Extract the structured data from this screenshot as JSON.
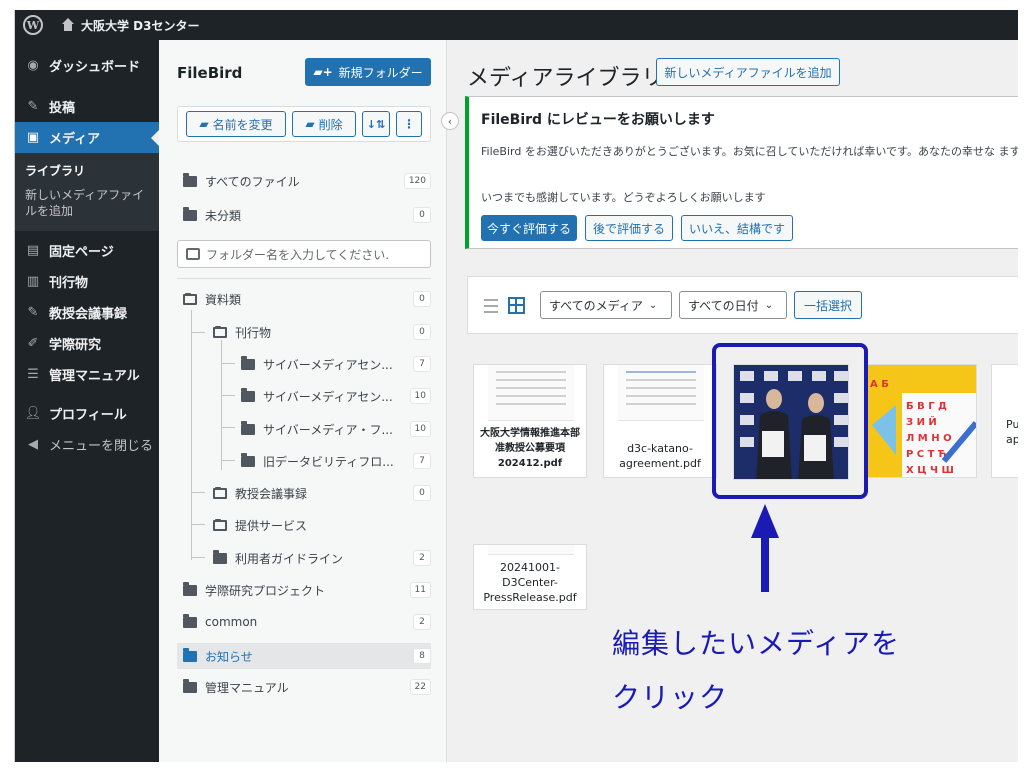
{
  "adminbar": {
    "site_name": "大阪大学 D3センター",
    "logo_glyph": "W"
  },
  "sidebar": {
    "items": [
      {
        "label": "ダッシュボード",
        "icon": "dashboard-icon"
      },
      {
        "label": "投稿",
        "icon": "pin-icon"
      },
      {
        "label": "メディア",
        "icon": "media-icon"
      },
      {
        "label": "固定ページ",
        "icon": "page-icon"
      },
      {
        "label": "刊行物",
        "icon": "book-icon"
      },
      {
        "label": "教授会議事録",
        "icon": "pin-icon"
      },
      {
        "label": "学際研究",
        "icon": "pencil-icon"
      },
      {
        "label": "管理マニュアル",
        "icon": "document-icon"
      },
      {
        "label": "プロフィール",
        "icon": "user-icon"
      },
      {
        "label": "メニューを閉じる",
        "icon": "collapse-icon"
      }
    ],
    "submenu": {
      "library": "ライブラリ",
      "add_new": "新しいメディアファイルを追加"
    }
  },
  "filebird": {
    "title": "FileBird",
    "new_folder": "新規フォルダー",
    "rename": "名前を変更",
    "delete": "削除",
    "all_files": {
      "label": "すべてのファイル",
      "count": "120"
    },
    "uncategorized": {
      "label": "未分類",
      "count": "0"
    },
    "search_placeholder": "フォルダー名を入力してください.",
    "folders": [
      {
        "label": "資料類",
        "count": "0"
      },
      {
        "label": "刊行物",
        "count": "0"
      },
      {
        "label": "サイバーメディアセン...",
        "count": "7"
      },
      {
        "label": "サイバーメディアセン...",
        "count": "10"
      },
      {
        "label": "サイバーメディア・フ...",
        "count": "10"
      },
      {
        "label": "旧データビリティフロ...",
        "count": "7"
      },
      {
        "label": "教授会議事録",
        "count": "0"
      },
      {
        "label": "提供サービス",
        "count": ""
      },
      {
        "label": "利用者ガイドライン",
        "count": "2"
      },
      {
        "label": "学際研究プロジェクト",
        "count": "11"
      },
      {
        "label": "common",
        "count": "2"
      },
      {
        "label": "お知らせ",
        "count": "8"
      },
      {
        "label": "管理マニュアル",
        "count": "22"
      }
    ]
  },
  "main": {
    "title": "メディアライブラリ",
    "add_new": "新しいメディアファイルを追加",
    "notice": {
      "title": "FileBird にレビューをお願いします",
      "text": "FileBird をお選びいただきありがとうございます。お気に召していただければ幸いです。あなたの幸せな ますか ?",
      "text2": "いつまでも感謝しています。どうぞよろしくお願いします",
      "rate_now": "今すぐ評価する",
      "rate_later": "後で評価する",
      "no_thanks": "いいえ、結構です"
    },
    "filters": {
      "media_type": "すべてのメディア",
      "date": "すべての日付",
      "bulk_select": "一括選択"
    },
    "thumbnails": [
      {
        "caption": "大阪大学情報推進本部准教授公募要項202412.pdf"
      },
      {
        "caption": "d3c-katano-agreement.pdf"
      },
      {
        "caption": "20241001-D3Center-PressRelease.pdf"
      },
      {
        "caption": "Pu ap"
      }
    ]
  },
  "annotation": {
    "line1": "編集したいメディアを",
    "line2": "クリック",
    "color": "#1a1ab5"
  },
  "colors": {
    "accent": "#2271b1",
    "sidebar": "#1d2327",
    "notice_border": "#00a32a"
  }
}
